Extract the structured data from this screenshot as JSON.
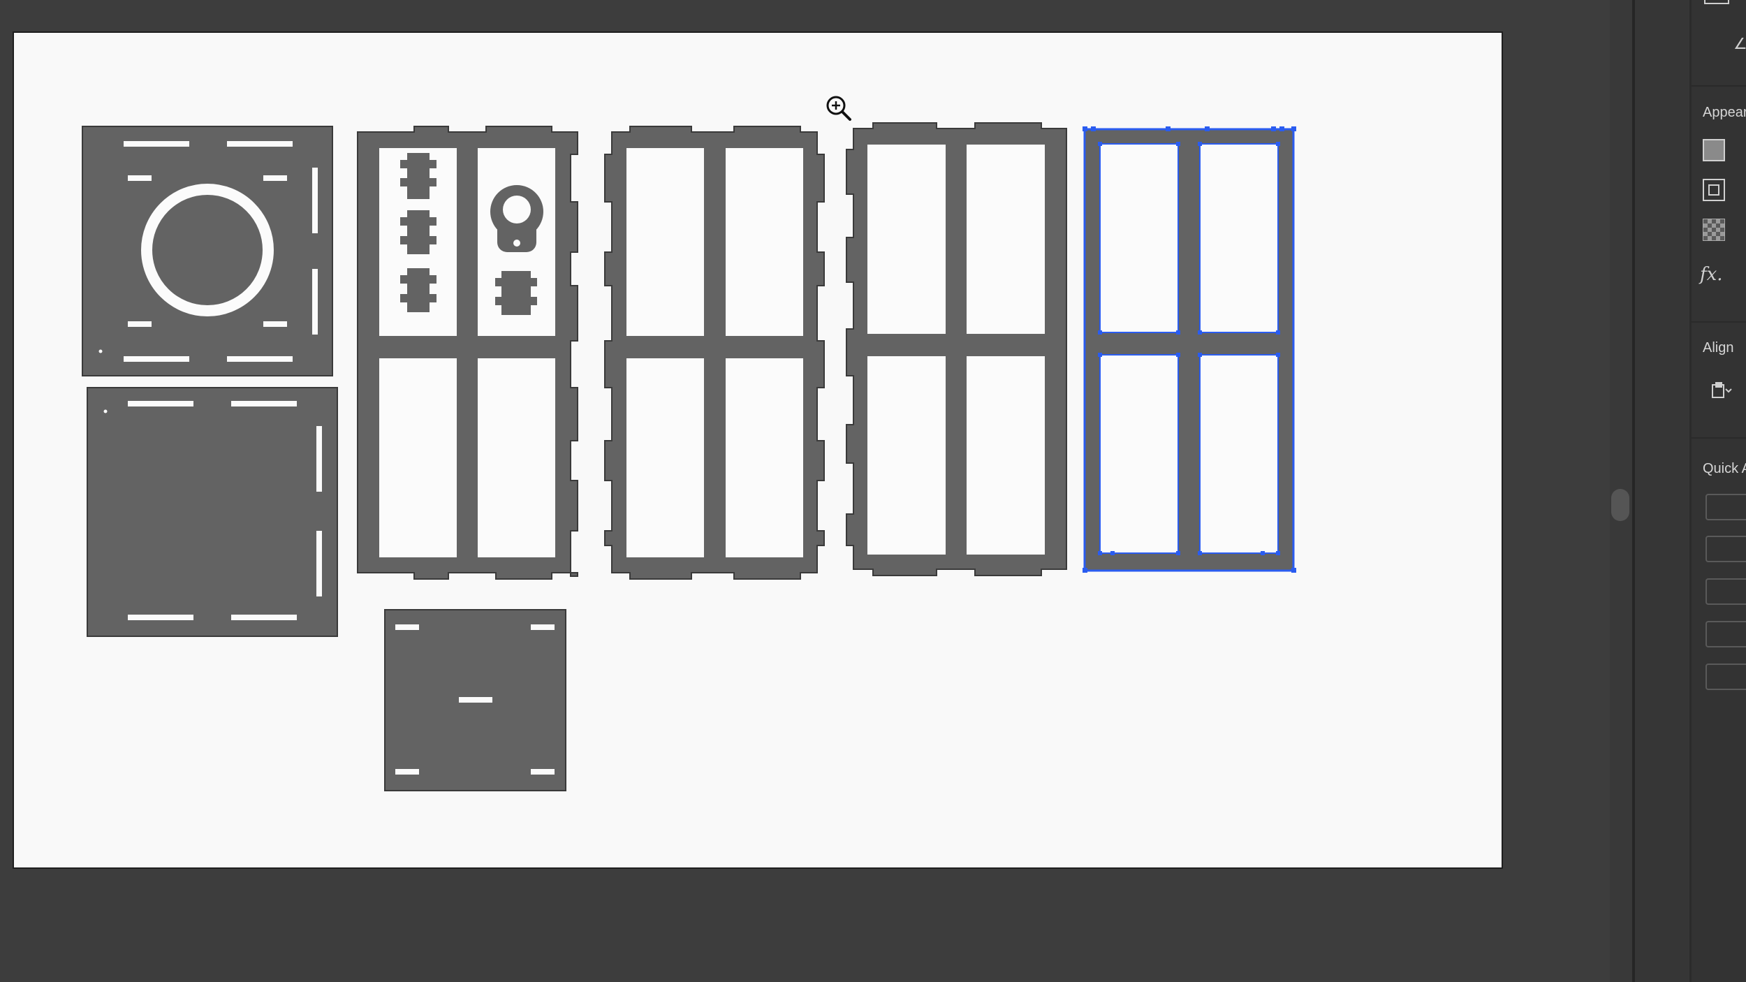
{
  "app": {
    "name": "Vector editor",
    "tool_cursor": "zoom-in-icon"
  },
  "colors": {
    "workspace": "#3d3d3d",
    "artboard": "#f9f9f9",
    "part_fill": "#636363",
    "selection": "#2a5cf0",
    "panel": "#333333"
  },
  "artboard": {
    "parts": [
      {
        "id": "panel-circle",
        "label": "box panel with round hole"
      },
      {
        "id": "panel-plain",
        "label": "box panel"
      },
      {
        "id": "panel-small",
        "label": "small square panel"
      },
      {
        "id": "frame-connectors",
        "label": "frame with connector cutouts"
      },
      {
        "id": "frame-2",
        "label": "frame"
      },
      {
        "id": "frame-3",
        "label": "frame"
      },
      {
        "id": "frame-selected",
        "label": "selected frame",
        "selected": true
      }
    ]
  },
  "properties_panel": {
    "appearance": {
      "title": "Appear",
      "icons": [
        "fill-swatch-icon",
        "stroke-swatch-icon",
        "opacity-icon",
        "fx-icon"
      ],
      "fx_label": "fx."
    },
    "align": {
      "title": "Align",
      "icons": [
        "align-to-artboard-icon",
        "chevron-down-icon"
      ]
    },
    "quick_actions": {
      "title": "Quick A",
      "button_count": 5
    }
  }
}
